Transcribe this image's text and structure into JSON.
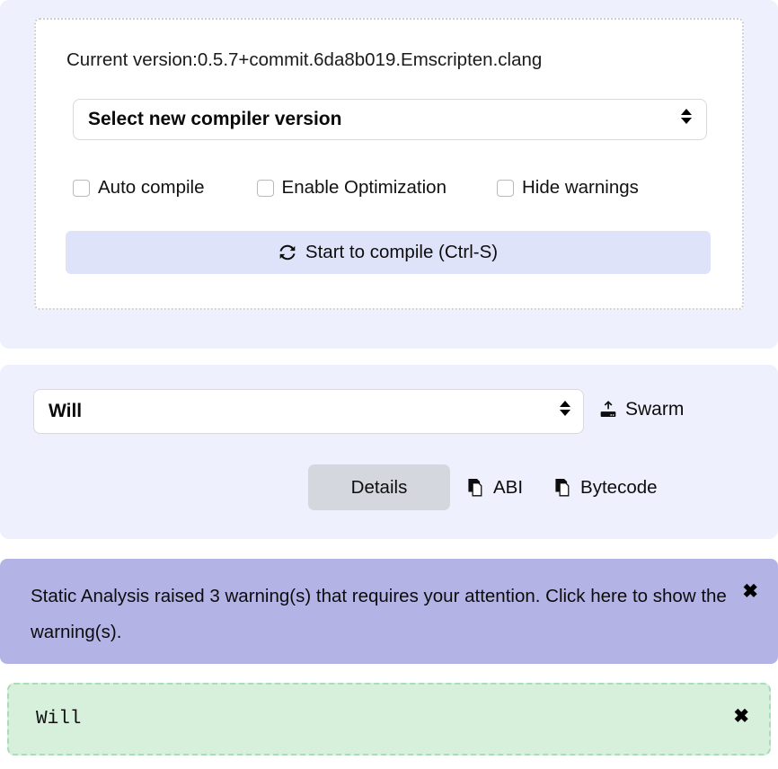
{
  "compiler_panel": {
    "current_version_label": "Current version:0.5.7+commit.6da8b019.Emscripten.clang",
    "version_select": {
      "value": "Select new compiler version",
      "icon": "chevron-up-down-icon"
    },
    "options": [
      {
        "label": "Auto compile",
        "checked": false
      },
      {
        "label": "Enable Optimization",
        "checked": false
      },
      {
        "label": "Hide warnings",
        "checked": false
      }
    ],
    "compile_button": {
      "label": "Start to compile (Ctrl-S)",
      "icon": "sync-icon",
      "background": "#dfe3fa"
    }
  },
  "contract_panel": {
    "contract_select": {
      "value": "Will",
      "icon": "chevron-up-down-icon"
    },
    "swarm_button": {
      "label": "Swarm",
      "icon": "upload-drive-icon"
    },
    "tabs": [
      {
        "label": "Details",
        "icon": null,
        "active": true
      },
      {
        "label": "ABI",
        "icon": "copy-icon",
        "active": false
      },
      {
        "label": "Bytecode",
        "icon": "copy-icon",
        "active": false
      }
    ],
    "active_tab_background": "#d4d7de"
  },
  "warning_alert": {
    "message": "Static Analysis raised 3 warning(s) that requires your attention. Click here to show the warning(s).",
    "warning_count": "3",
    "close_label": "✖",
    "background": "#b4b3e6"
  },
  "success_box": {
    "text": "Will",
    "close_label": "✖",
    "background": "#d6f0dc",
    "border_color": "#aadcb8"
  },
  "theme": {
    "panel_background": "#eef0fd",
    "page_background": "#ffffff"
  }
}
